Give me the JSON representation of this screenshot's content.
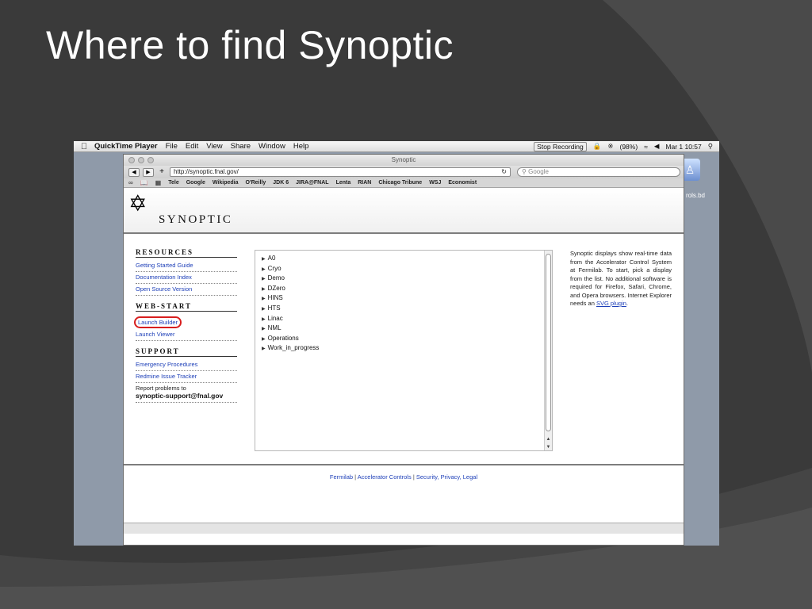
{
  "slide": {
    "title": "Where to find Synoptic"
  },
  "menubar": {
    "app": "QuickTime Player",
    "items": [
      "File",
      "Edit",
      "View",
      "Share",
      "Window",
      "Help"
    ],
    "stop_recording": "Stop Recording",
    "battery": "(98%)",
    "datetime": "Mar 1  10:57"
  },
  "desktop": {
    "label": "rols.bd"
  },
  "browser": {
    "window_title": "Synoptic",
    "url": "http://synoptic.fnal.gov/",
    "search_placeholder": "Google",
    "bookmarks": [
      "Tele",
      "Google",
      "Wikipedia",
      "O'Reilly",
      "JDK 6",
      "JIRA@FNAL",
      "Lenta",
      "RIAN",
      "Chicago Tribune",
      "WSJ",
      "Economist"
    ]
  },
  "site": {
    "logo_text": "SYNOPTIC",
    "resources": {
      "heading": "RESOURCES",
      "links": [
        "Getting Started Guide",
        "Documentation Index",
        "Open Source Version"
      ]
    },
    "webstart": {
      "heading": "WEB-START",
      "links": [
        "Launch Builder",
        "Launch Viewer"
      ]
    },
    "support": {
      "heading": "SUPPORT",
      "links": [
        "Emergency Procedures",
        "Redmine Issue Tracker"
      ],
      "report_text": "Report problems to",
      "email": "synoptic-support@fnal.gov"
    },
    "tree": [
      "A0",
      "Cryo",
      "Demo",
      "DZero",
      "HINS",
      "HTS",
      "Linac",
      "NML",
      "Operations",
      "Work_in_progress"
    ],
    "description": "Synoptic displays show real-time data from the Accelerator Control System at Fermilab. To start, pick a display from the list. No additional software is required for Firefox, Safari, Chrome, and Opera browsers. Internet Explorer needs an",
    "description_link": "SVG plugin",
    "footer": [
      "Fermilab",
      "Accelerator Controls",
      "Security, Privacy, Legal"
    ]
  },
  "colors": {
    "slide_bg": "#3b3b3b",
    "link": "#1d3fb8",
    "circle": "#d81e1e"
  }
}
